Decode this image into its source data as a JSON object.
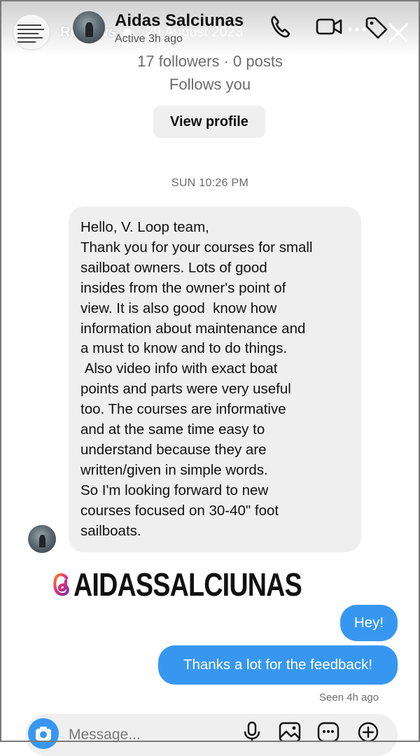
{
  "story": {
    "title": "Reviews",
    "date": "29 August 2023"
  },
  "contact": {
    "name": "Aidas Salciunas",
    "status": "Active 3h ago",
    "stats": "17 followers · 0 posts",
    "relation": "Follows you",
    "view_profile_label": "View profile"
  },
  "header_icons": [
    "phone-icon",
    "video-camera-icon",
    "more-icon",
    "tag-icon",
    "close-icon"
  ],
  "conversation": {
    "timestamp": "SUN 10:26 PM",
    "incoming_message": "Hello, V. Loop team,\nThank you for your courses for small\nsailboat owners. Lots of good\ninsides from the owner's point of\nview. It is also good  know how\ninformation about maintenance and\na must to know and to do things.\n Also video info with exact boat\npoints and parts were very useful\ntoo. The courses are informative\nand at the same time easy to\nunderstand because they are\nwritten/given in simple words.\nSo I'm looking forward to new\ncourses focused on 30-40\" foot\nsailboats.",
    "outgoing": [
      "Hey!",
      "Thanks a lot for the feedback!"
    ],
    "seen": "Seen 4h ago"
  },
  "mention": {
    "handle": "AIDASSALCIUNAS"
  },
  "composer": {
    "placeholder": "Message..."
  },
  "colors": {
    "accent": "#3797f0",
    "bubble_incoming": "#efefef"
  }
}
